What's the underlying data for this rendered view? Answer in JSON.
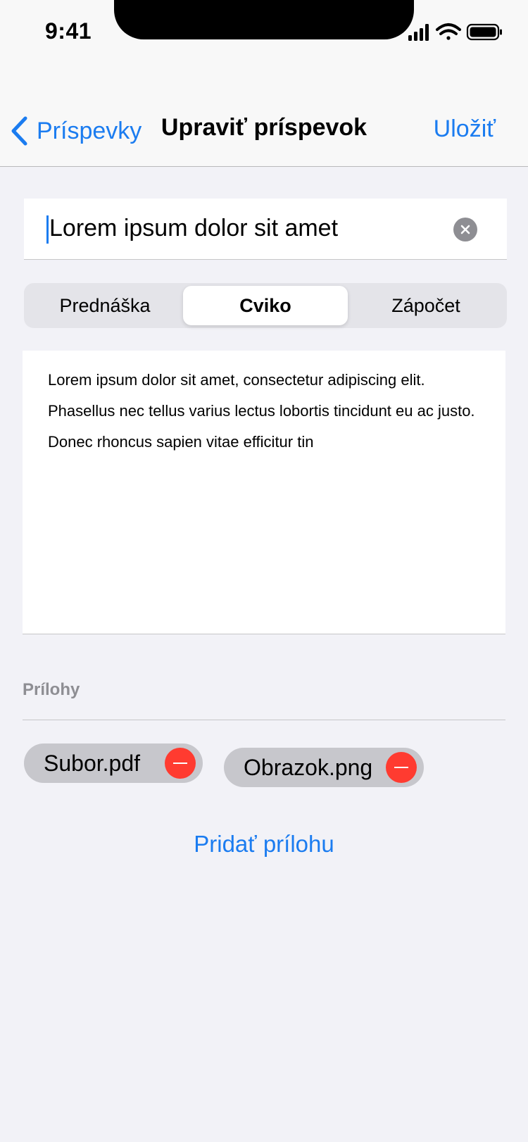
{
  "status_bar": {
    "time": "9:41"
  },
  "navigation": {
    "back_label": "Príspevky",
    "title": "Upraviť príspevok",
    "save_label": "Uložiť"
  },
  "title_field": {
    "value": "Lorem ipsum dolor sit amet"
  },
  "segmented_control": {
    "segments": [
      "Prednáška",
      "Cviko",
      "Zápočet"
    ],
    "selected": "Cviko"
  },
  "body_text": "Lorem ipsum dolor sit amet, consectetur adipiscing elit. Phasellus nec tellus varius lectus lobortis tincidunt eu ac justo. Donec rhoncus sapien vitae efficitur tin",
  "attachments": {
    "section_label": "Prílohy",
    "items": [
      "Subor.pdf",
      "Obrazok.png"
    ],
    "add_label": "Pridať prílohu"
  },
  "colors": {
    "accent": "#1B7CF0",
    "destructive": "#FF3B30",
    "background": "#F2F2F7"
  }
}
